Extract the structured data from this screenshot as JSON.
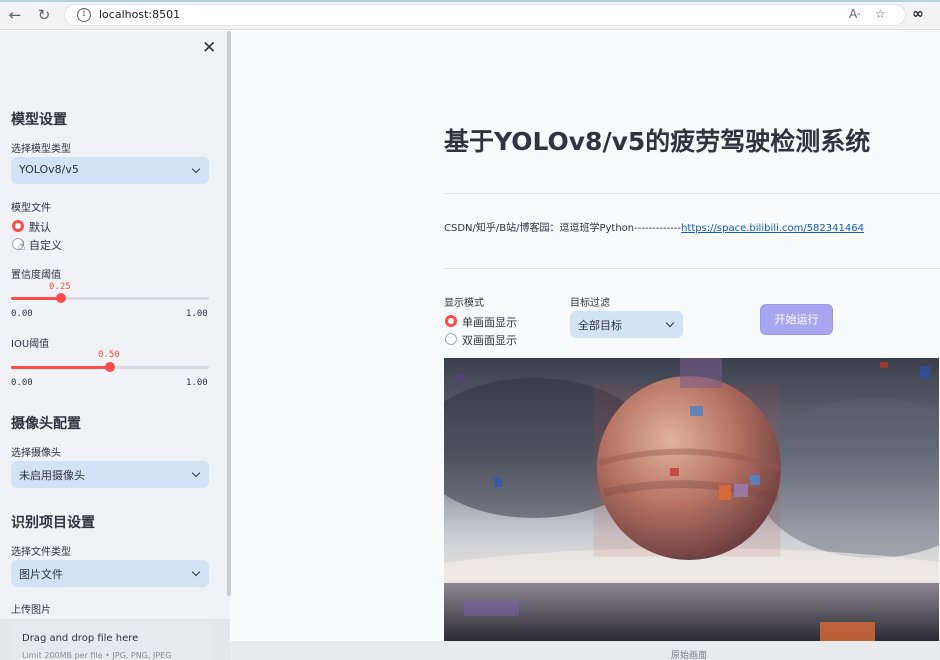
{
  "browser": {
    "url": "localhost:8501",
    "back_icon": "arrow-left-icon",
    "reload_icon": "reload-icon",
    "info_icon": "info-icon",
    "read_aloud_icon": "read-aloud-icon",
    "favorite_icon": "star-icon",
    "menu_icon": "infinity-icon"
  },
  "sidebar": {
    "close_icon": "close-icon",
    "model_section": {
      "heading": "模型设置",
      "model_type_label": "选择模型类型",
      "model_type_value": "YOLOv8/v5",
      "model_file_label": "模型文件",
      "model_file_options": [
        "默认",
        "自定义"
      ],
      "model_file_selected": "默认"
    },
    "confidence": {
      "label": "置信度阈值",
      "value": "0.25",
      "min": "0.00",
      "max": "1.00",
      "fraction": 0.25
    },
    "iou": {
      "label": "IOU阈值",
      "value": "0.50",
      "min": "0.00",
      "max": "1.00",
      "fraction": 0.5
    },
    "camera_section": {
      "heading": "摄像头配置",
      "camera_label": "选择摄像头",
      "camera_value": "未启用摄像头"
    },
    "project_section": {
      "heading": "识别项目设置",
      "file_type_label": "选择文件类型",
      "file_type_value": "图片文件",
      "upload_label": "上传图片",
      "upload_title": "Drag and drop file here",
      "upload_limit": "Limit 200MB per file • JPG, PNG, JPEG"
    }
  },
  "main": {
    "title": "基于YOLOv8/v5的疲劳驾驶检测系统",
    "credit_prefix": "CSDN/知乎/B站/博客园：逗逗班学Python-------------",
    "credit_link": "https://space.bilibili.com/582341464",
    "display_mode_label": "显示模式",
    "display_mode_options": [
      "单画面显示",
      "双画面显示"
    ],
    "display_mode_selected": "单画面显示",
    "target_filter_label": "目标过滤",
    "target_filter_value": "全部目标",
    "run_button": "开始运行",
    "image_caption": "原始画面"
  },
  "colors": {
    "accent": "#ff4b4b",
    "select_bg": "#d2e3f8",
    "run_button": "#a9a6f0",
    "link": "#0f5bbf"
  }
}
